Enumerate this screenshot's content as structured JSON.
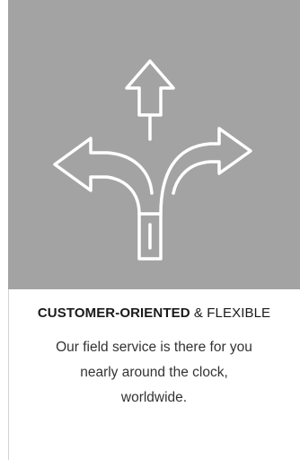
{
  "card": {
    "icon": "split-arrows-icon",
    "panel_color": "#a3a3a3",
    "heading_strong": "CUSTOMER-ORIENTED",
    "heading_rest": " & FLEXIBLE",
    "description_lines": [
      "Our field service is there for you",
      "nearly around the clock,",
      "worldwide."
    ]
  }
}
